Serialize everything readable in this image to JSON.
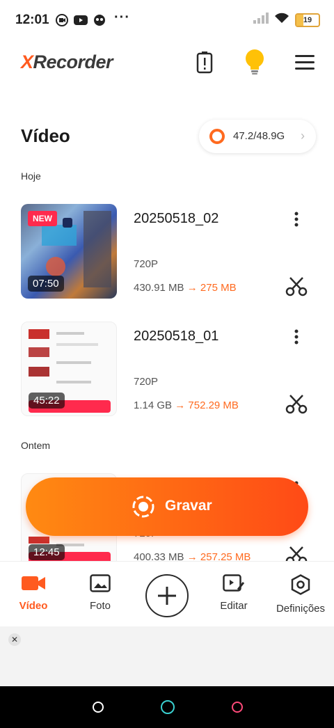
{
  "status_bar": {
    "time": "12:01",
    "dots": "···",
    "battery": "19"
  },
  "app": {
    "logo_x": "X",
    "logo_rest": "Recorder"
  },
  "page": {
    "title": "Vídeo",
    "storage": "47.2/48.9G"
  },
  "sections": {
    "today": "Hoje",
    "yesterday": "Ontem"
  },
  "videos": [
    {
      "title": "20250518_02",
      "resolution": "720P",
      "size_old": "430.91 MB",
      "arrow": "→",
      "size_new": "275 MB",
      "duration": "07:50",
      "badge": "NEW"
    },
    {
      "title": "20250518_01",
      "resolution": "720P",
      "size_old": "1.14 GB",
      "arrow": "→",
      "size_new": "752.29 MB",
      "duration": "45:22"
    },
    {
      "title": "",
      "resolution": "720P",
      "size_old": "400.33 MB",
      "arrow": "→",
      "size_new": "257.25 MB",
      "duration": "12:45"
    }
  ],
  "record_button": {
    "label": "Gravar"
  },
  "bottom_nav": {
    "video": "Vídeo",
    "photo": "Foto",
    "edit": "Editar",
    "settings": "Definições"
  },
  "ad": {
    "close": "✕"
  },
  "colors": {
    "accent": "#ff5a1f",
    "record_start": "#ff8a12",
    "record_end": "#ff4a16"
  }
}
